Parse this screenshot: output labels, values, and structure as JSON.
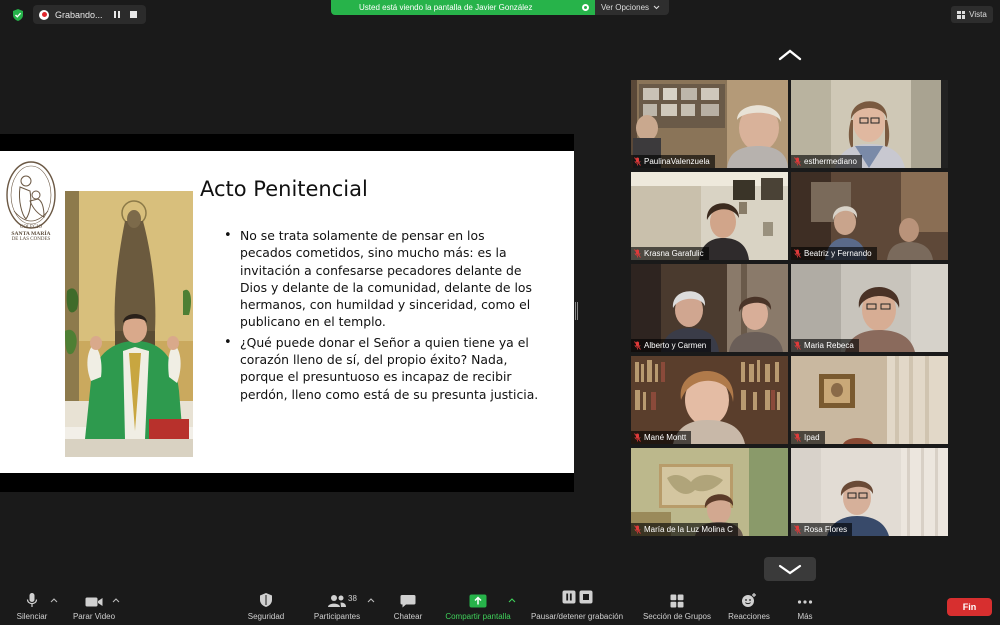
{
  "topbar": {
    "recording_label": "Grabando...",
    "share_banner_text": "Usted está viendo la pantalla de Javier González",
    "view_options_label": "Ver Opciones",
    "view_button_label": "Vista"
  },
  "slide": {
    "title": "Acto Penitencial",
    "logo_line1": "COLEGIO",
    "logo_line2": "SANTA MARÍA",
    "logo_line3": "DE LAS CONDES",
    "bullets": [
      "No se trata solamente de pensar en los pecados cometidos, sino mucho más: es la invitación a confesarse pecadores delante de Dios y delante de la comunidad, delante de los hermanos, con humildad y sinceridad, como el publicano en el templo.",
      "¿Qué puede donar el Señor a quien tiene ya el corazón lleno de sí, del propio éxito? Nada, porque el presuntuoso es incapaz de recibir perdón, lleno como está de su presunta justicia."
    ]
  },
  "participants": [
    {
      "name": "PaulinaValenzuela"
    },
    {
      "name": "esthermediano"
    },
    {
      "name": "Krasna Garafulic"
    },
    {
      "name": "Beatriz y Fernando"
    },
    {
      "name": "Alberto y Carmen"
    },
    {
      "name": "Maria Rebeca"
    },
    {
      "name": "Mané Montt"
    },
    {
      "name": "Ipad"
    },
    {
      "name": "María de la Luz Molina C"
    },
    {
      "name": "Rosa Flores"
    }
  ],
  "toolbar": {
    "mute_label": "Silenciar",
    "video_label": "Parar Video",
    "security_label": "Seguridad",
    "participants_label": "Participantes",
    "participants_count": "38",
    "chat_label": "Chatear",
    "share_label": "Compartir pantalla",
    "record_label": "Pausar/detener grabación",
    "breakout_label": "Sección de Grupos",
    "reactions_label": "Reacciones",
    "more_label": "Más",
    "end_label": "Fin"
  },
  "colors": {
    "share_green": "#27b34a",
    "end_red": "#d72f2f",
    "background": "#1a1a1a"
  }
}
